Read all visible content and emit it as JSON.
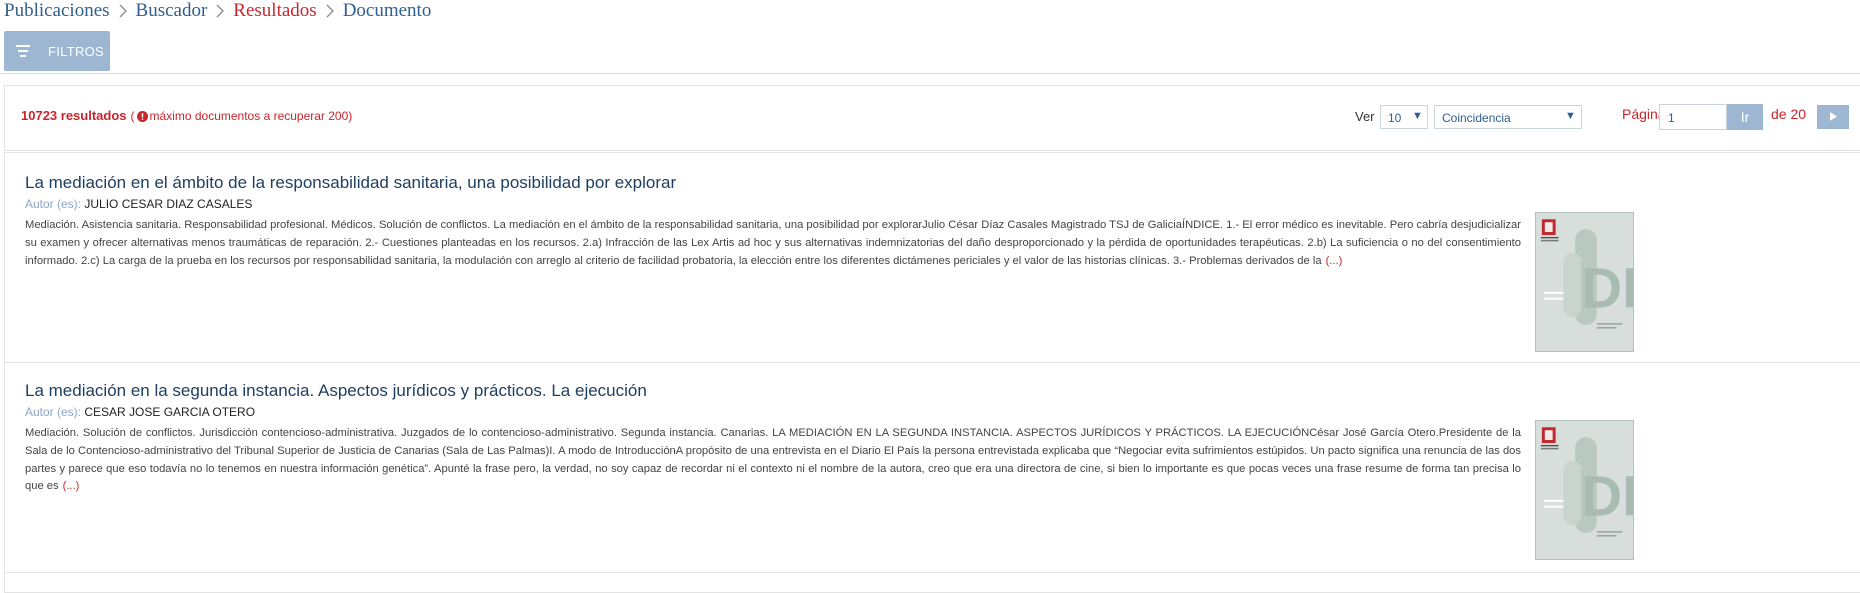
{
  "breadcrumb": {
    "items": [
      "Publicaciones",
      "Buscador",
      "Resultados",
      "Documento"
    ]
  },
  "filters": {
    "label": "FILTROS"
  },
  "results_bar": {
    "count": "10723 resultados",
    "open_paren": "(",
    "max_note": "máximo documentos a recuperar 200)",
    "ver_label": "Ver",
    "per_page": "10",
    "order": "Coincidencia",
    "pagina_label": "Página",
    "page_value": "1",
    "go_label": "Ir",
    "total_pages": "de 20"
  },
  "results": [
    {
      "title": "La mediación en el ámbito de la responsabilidad sanitaria, una posibilidad por explorar",
      "author_label": "Autor (es):",
      "author": "JULIO CESAR DIAZ CASALES",
      "abstract": "Mediación. Asistencia sanitaria. Responsabilidad profesional. Médicos. Solución de conflictos. La mediación en el ámbito de la responsabilidad sanitaria, una posibilidad por explorarJulio César Díaz Casales Magistrado TSJ de GaliciaÍNDICE. 1.- El error médico es inevitable. Pero cabría desjudicializar su examen y ofrecer alternativas menos traumáticas de reparación. 2.- Cuestiones planteadas en los recursos. 2.a) Infracción de las Lex Artis ad hoc y sus alternativas indemnizatorias del daño desproporcionado y la pérdida de oportunidades terapéuticas. 2.b) La suficiencia o no del consentimiento informado. 2.c) La carga de la prueba en los recursos por responsabilidad sanitaria, la modulación con arreglo al criterio de facilidad probatoria, la elección entre los diferentes dictámenes periciales y el valor de las historias clínicas. 3.- Problemas derivados de la",
      "more": "(...)"
    },
    {
      "title": "La mediación en la segunda instancia. Aspectos jurídicos y prácticos. La ejecución",
      "author_label": "Autor (es):",
      "author": "CESAR JOSE GARCIA OTERO",
      "abstract": "Mediación. Solución de conflictos. Jurisdicción contencioso-administrativa. Juzgados de lo contencioso-administrativo. Segunda instancia. Canarias. LA MEDIACIÓN EN LA SEGUNDA INSTANCIA. ASPECTOS JURÍDICOS Y PRÁCTICOS. LA EJECUCIÓNCésar José García Otero.Presidente de la Sala de lo Contencioso-administrativo del Tribunal Superior de Justicia de Canarias (Sala de Las Palmas)I. A modo de IntroducciónA propósito de una entrevista en el Diario El País la persona entrevistada explicaba que “Negociar evita sufrimientos estúpidos. Un pacto significa una renuncia de las dos partes y parece que eso todavía no lo tenemos en nuestra información genética”. Apunté la frase pero, la verdad, no soy capaz de recordar ni el contexto ni el nombre de la autora, creo que era una directora de cine, si bien lo importante es que pocas veces una frase resume de forma tan precisa lo que es",
      "more": "(...)"
    }
  ],
  "colors": {
    "link_blue": "#2f5f8f",
    "accent_red": "#c8262c",
    "button_blue": "#9db7d3"
  },
  "icons": [
    "chevron-right-icon",
    "filter-icon",
    "warning-icon",
    "caret-down-icon",
    "arrow-right-icon",
    "document-cover-icon"
  ]
}
